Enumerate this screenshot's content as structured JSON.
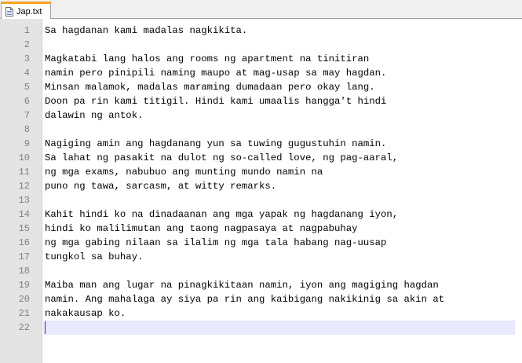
{
  "tab": {
    "label": "Jap.txt"
  },
  "editor": {
    "lines": [
      "Sa hagdanan kami madalas nagkikita.",
      "",
      "Magkatabi lang halos ang rooms ng apartment na tinitiran",
      "namin pero pinipili naming maupo at mag-usap sa may hagdan.",
      "Minsan malamok, madalas maraming dumadaan pero okay lang.",
      "Doon pa rin kami titigil. Hindi kami umaalis hangga't hindi",
      "dalawin ng antok.",
      "",
      "Nagiging amin ang hagdanang yun sa tuwing gugustuhin namin.",
      "Sa lahat ng pasakit na dulot ng so-called love, ng pag-aaral,",
      "ng mga exams, nabubuo ang munting mundo namin na",
      "puno ng tawa, sarcasm, at witty remarks.",
      "",
      "Kahit hindi ko na dinadaanan ang mga yapak ng hagdanang iyon,",
      "hindi ko malilimutan ang taong nagpasaya at nagpabuhay",
      "ng mga gabing nilaan sa ilalim ng mga tala habang nag-uusap",
      "tungkol sa buhay.",
      "",
      "Maiba man ang lugar na pinagkikitaan namin, iyon ang magiging hagdan",
      "namin. Ang mahalaga ay siya pa rin ang kaibigang nakikinig sa akin at",
      "nakakausap ko.",
      ""
    ],
    "current_line": 22
  },
  "colors": {
    "tab_accent": "#f7a41d",
    "gutter_bg": "#e4e4e4",
    "current_line_bg": "#e8e8ff",
    "caret": "#8000ff"
  }
}
